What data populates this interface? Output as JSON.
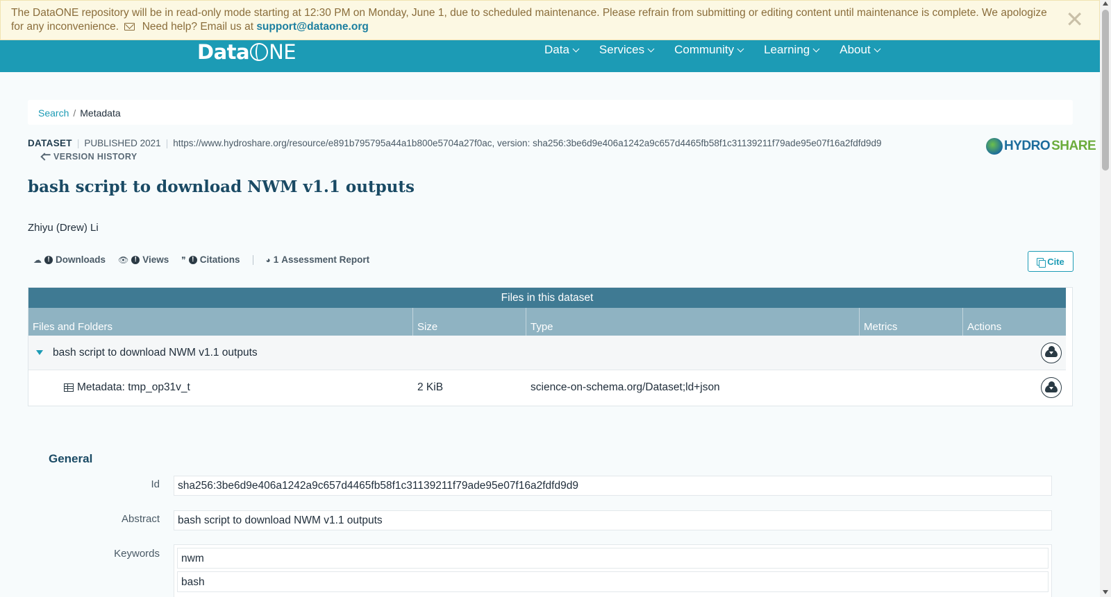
{
  "banner": {
    "message": "The DataONE repository will be in read-only mode starting at 12:30 PM on Monday, June 1, due to scheduled maintenance. Please refrain from submitting or editing content until maintenance is complete. We apologize for any inconvenience.",
    "help_text": "Need help? Email us at",
    "email": "support@dataone.org",
    "close": "✕"
  },
  "brand": {
    "logo_left": "Data",
    "logo_right": "NE"
  },
  "nav": {
    "data": "Data",
    "services": "Services",
    "community": "Community",
    "learning": "Learning",
    "about": "About"
  },
  "breadcrumb": {
    "search": "Search",
    "sep": "/",
    "current": "Metadata"
  },
  "meta": {
    "type": "DATASET",
    "published": "PUBLISHED 2021",
    "pipe": "|",
    "identifier": "https://www.hydroshare.org/resource/e891b795795a44a1b800e5704a27f0ac, version: sha256:3be6d9e406a1242a9c657d4465fb58f1c31139211f79ade95e07f16a2fdfd9d9",
    "version_history": "VERSION HISTORY",
    "repo_logo_a": "HYDRO",
    "repo_logo_b": "SHARE"
  },
  "title": "bash script to download NWM v1.1 outputs",
  "author": "Zhiyu (Drew) Li",
  "metrics": {
    "downloads": "Downloads",
    "views": "Views",
    "citations": "Citations",
    "bang": "!",
    "assessment_count": "1",
    "assessment": "Assessment Report",
    "cite": "Cite",
    "icon_download": "☁",
    "icon_view": "👁",
    "icon_quote": "❞",
    "icon_gauge": "◕"
  },
  "files": {
    "heading": "Files in this dataset",
    "columns": [
      "Files and Folders",
      "Size",
      "Type",
      "Metrics",
      "Actions"
    ],
    "folder": "bash script to download NWM v1.1 outputs",
    "file": {
      "name": "Metadata: tmp_op31v_t",
      "size": "2 KiB",
      "type": "science-on-schema.org/Dataset;ld+json"
    }
  },
  "general": {
    "title": "General",
    "id_label": "Id",
    "id_value": "sha256:3be6d9e406a1242a9c657d4465fb58f1c31139211f79ade95e07f16a2fdfd9d9",
    "abstract_label": "Abstract",
    "abstract_value": "bash script to download NWM v1.1 outputs",
    "keywords_label": "Keywords",
    "keywords": [
      "nwm",
      "bash"
    ]
  }
}
